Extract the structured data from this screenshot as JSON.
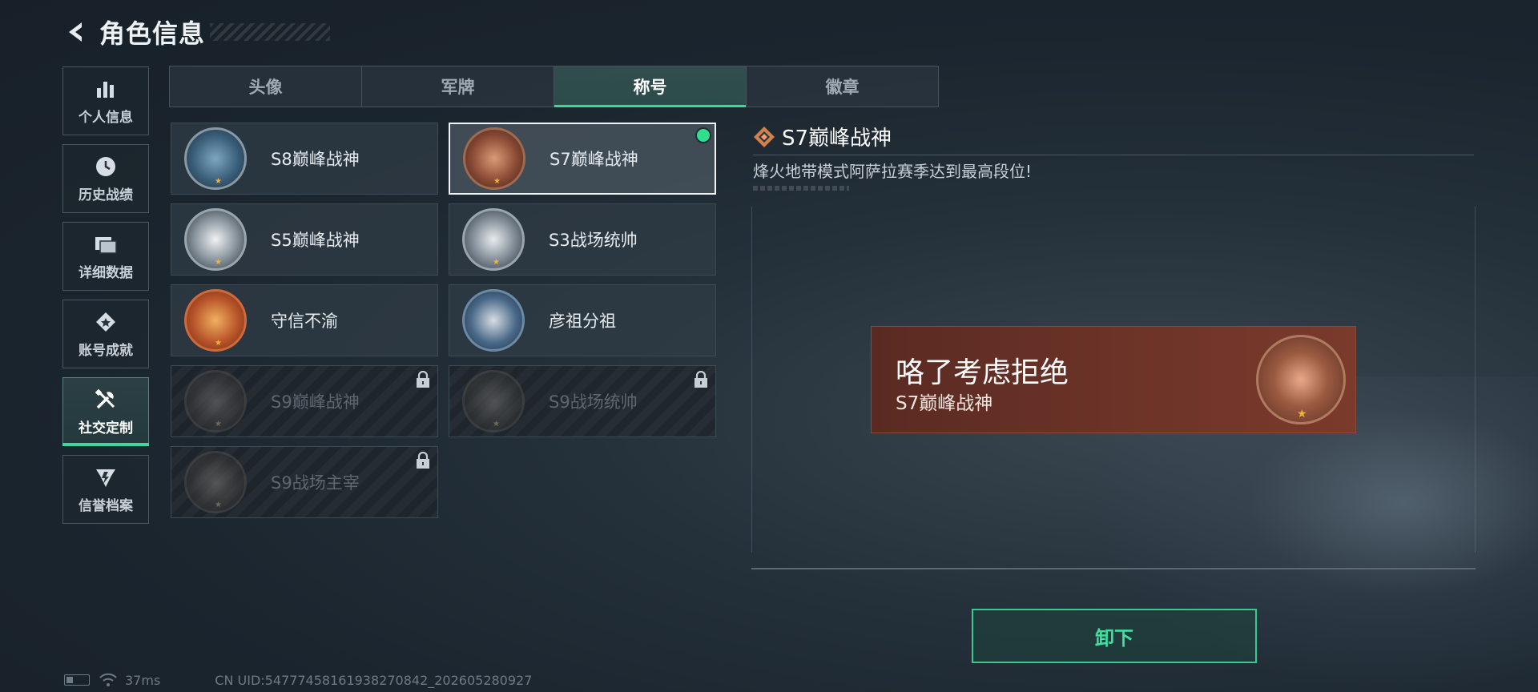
{
  "header": {
    "title": "角色信息"
  },
  "nav": [
    {
      "label": "个人信息",
      "icon": "bar-chart-icon",
      "active": false
    },
    {
      "label": "历史战绩",
      "icon": "clock-icon",
      "active": false
    },
    {
      "label": "详细数据",
      "icon": "folder-icon",
      "active": false
    },
    {
      "label": "账号成就",
      "icon": "achievement-icon",
      "active": false
    },
    {
      "label": "社交定制",
      "icon": "tools-icon",
      "active": true
    },
    {
      "label": "信誉档案",
      "icon": "credit-icon",
      "active": false
    }
  ],
  "tabs": [
    {
      "label": "头像",
      "active": false
    },
    {
      "label": "军牌",
      "active": false
    },
    {
      "label": "称号",
      "active": true
    },
    {
      "label": "徽章",
      "active": false
    }
  ],
  "titles": [
    {
      "name": "S8巅峰战神",
      "locked": false,
      "selected": false,
      "equipped": false,
      "emblem_color": "#3a5f7a"
    },
    {
      "name": "S7巅峰战神",
      "locked": false,
      "selected": true,
      "equipped": true,
      "emblem_color": "#6b3a2a"
    },
    {
      "name": "S5巅峰战神",
      "locked": false,
      "selected": false,
      "equipped": false,
      "emblem_color": "#2e3a44"
    },
    {
      "name": "S3战场统帅",
      "locked": false,
      "selected": false,
      "equipped": false,
      "emblem_color": "#37434d"
    },
    {
      "name": "守信不渝",
      "locked": false,
      "selected": false,
      "equipped": false,
      "emblem_color": "#8a3a20"
    },
    {
      "name": "彦祖分祖",
      "locked": false,
      "selected": false,
      "equipped": false,
      "emblem_color": "#2f4a66"
    },
    {
      "name": "S9巅峰战神",
      "locked": true,
      "selected": false,
      "equipped": false,
      "emblem_color": "#4a4640"
    },
    {
      "name": "S9战场统帅",
      "locked": true,
      "selected": false,
      "equipped": false,
      "emblem_color": "#46443e"
    },
    {
      "name": "S9战场主宰",
      "locked": true,
      "selected": false,
      "equipped": false,
      "emblem_color": "#4a443c"
    }
  ],
  "detail": {
    "title": "S7巅峰战神",
    "description": "烽火地带模式阿萨拉赛季达到最高段位!"
  },
  "banner": {
    "player_name": "咯了考虑拒绝",
    "title": "S7巅峰战神"
  },
  "actions": {
    "unequip_label": "卸下"
  },
  "status": {
    "ping": "37ms",
    "uid": "CN UID:54777458161938270842_202605280927"
  },
  "colors": {
    "accent": "#3fd6a0",
    "equipped_dot": "#2ee08d",
    "banner": "#6a3227"
  }
}
